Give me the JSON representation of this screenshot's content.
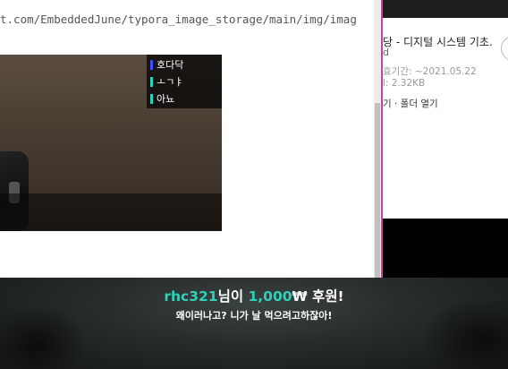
{
  "editor": {
    "url_text": "t.com/EmbeddedJune/typora_image_storage/main/img/imag"
  },
  "vote": {
    "options": [
      {
        "label": "호다닥",
        "color": "#3a4fff"
      },
      {
        "label": "ㅗㄱㅑ",
        "color": "#2fd1b8"
      },
      {
        "label": "아뇨",
        "color": "#2fd1b8"
      }
    ]
  },
  "panel": {
    "title": "당 - 디지털 시스템 기초.",
    "title_cont": "d",
    "modified": "효기간: ~2021.05.22",
    "size": "l: 2.32KB",
    "actions": "기 · 폴더 열기"
  },
  "overlay": {
    "donor": "rhc321",
    "donor_suffix": "님이 ",
    "amount": "1,000",
    "currency": "₩",
    "donation_word": " 후원!",
    "message": "왜이러나고? 니가 날 먹으려고하잖아!"
  }
}
